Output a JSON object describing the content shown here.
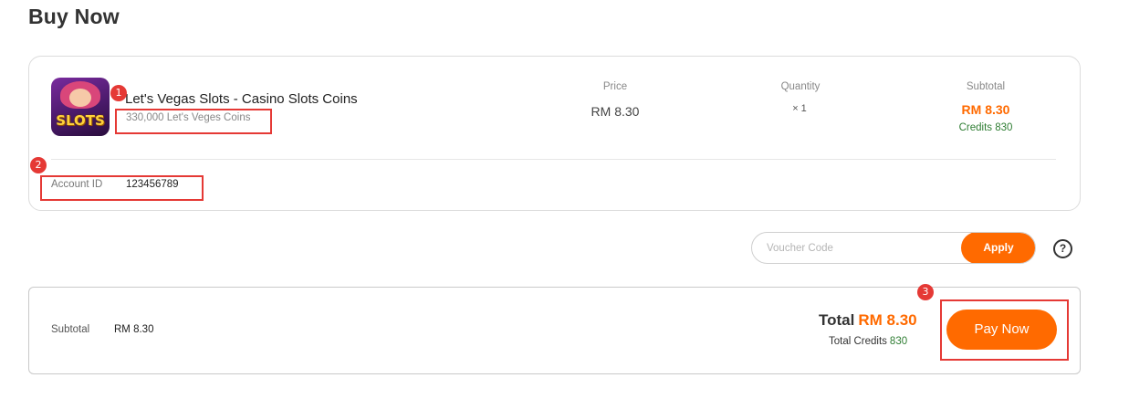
{
  "page": {
    "title": "Buy Now"
  },
  "product": {
    "name": "Let's Vegas Slots - Casino Slots Coins",
    "variant": "330,000 Let's Veges Coins",
    "thumb_text": "SLOTS",
    "price_header": "Price",
    "price": "RM 8.30",
    "quantity_header": "Quantity",
    "quantity": "× 1",
    "subtotal_header": "Subtotal",
    "subtotal": "RM 8.30",
    "credits": "Credits 830",
    "account_label": "Account ID",
    "account_value": "123456789"
  },
  "annotations": {
    "marker1": "1",
    "marker2": "2",
    "marker3": "3"
  },
  "voucher": {
    "placeholder": "Voucher Code",
    "apply_label": "Apply",
    "help_glyph": "?"
  },
  "summary": {
    "subtotal_label": "Subtotal",
    "subtotal_value": "RM 8.30",
    "total_label": "Total",
    "total_value": "RM 8.30",
    "total_credits_label": "Total Credits",
    "total_credits_value": "830",
    "pay_label": "Pay Now"
  },
  "colors": {
    "accent": "#ff6a00",
    "credits": "#2e7d32",
    "highlight": "#e53935"
  }
}
